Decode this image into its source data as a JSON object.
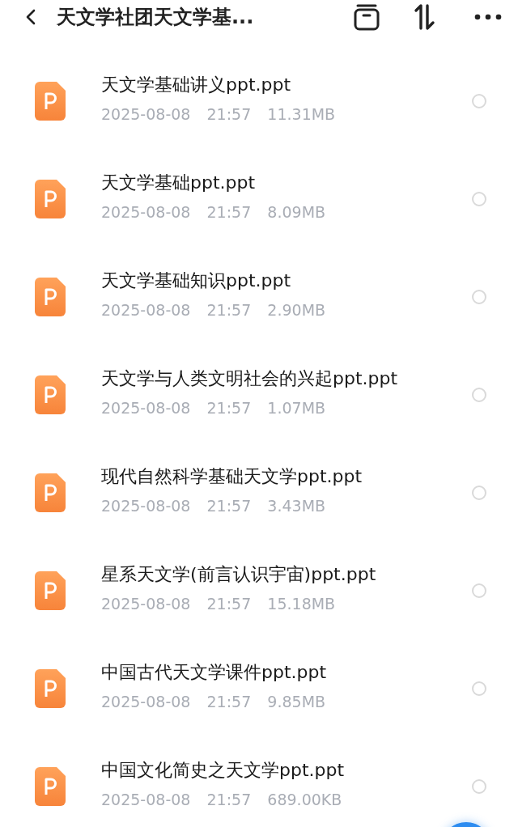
{
  "header": {
    "title": "天文学社团天文学基..."
  },
  "files": [
    {
      "name": "天文学基础讲义ppt.ppt",
      "date": "2025-08-08",
      "time": "21:57",
      "size": "11.31MB",
      "selected": false
    },
    {
      "name": "天文学基础ppt.ppt",
      "date": "2025-08-08",
      "time": "21:57",
      "size": "8.09MB",
      "selected": false
    },
    {
      "name": "天文学基础知识ppt.ppt",
      "date": "2025-08-08",
      "time": "21:57",
      "size": "2.90MB",
      "selected": false
    },
    {
      "name": "天文学与人类文明社会的兴起ppt.ppt",
      "date": "2025-08-08",
      "time": "21:57",
      "size": "1.07MB",
      "selected": false
    },
    {
      "name": "现代自然科学基础天文学ppt.ppt",
      "date": "2025-08-08",
      "time": "21:57",
      "size": "3.43MB",
      "selected": false
    },
    {
      "name": "星系天文学(前言认识宇宙)ppt.ppt",
      "date": "2025-08-08",
      "time": "21:57",
      "size": "15.18MB",
      "selected": false
    },
    {
      "name": "中国古代天文学课件ppt.ppt",
      "date": "2025-08-08",
      "time": "21:57",
      "size": "9.85MB",
      "selected": false
    },
    {
      "name": "中国文化简史之天文学ppt.ppt",
      "date": "2025-08-08",
      "time": "21:57",
      "size": "689.00KB",
      "selected": false
    }
  ]
}
